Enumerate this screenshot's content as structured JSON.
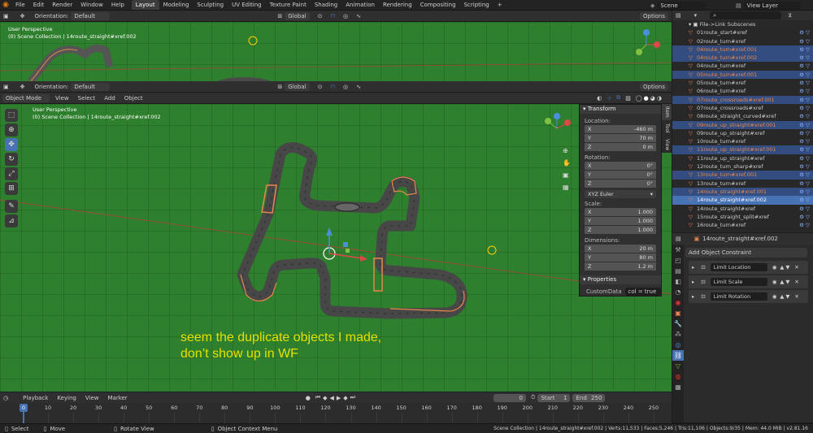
{
  "topbar": {
    "menus": [
      "File",
      "Edit",
      "Render",
      "Window",
      "Help"
    ],
    "workspaces": [
      "Layout",
      "Modeling",
      "Sculpting",
      "UV Editing",
      "Texture Paint",
      "Shading",
      "Animation",
      "Rendering",
      "Compositing",
      "Scripting"
    ],
    "active_workspace": "Layout",
    "scene": "Scene",
    "view_layer": "View Layer"
  },
  "viewport_top": {
    "orientation_label": "Orientation:",
    "orientation_value": "Default",
    "transform_space": "Global",
    "options": "Options",
    "overlay_line1": "User Perspective",
    "overlay_line2": "(0) Scene Collection | 14route_straight#xref.002"
  },
  "viewport_main": {
    "orientation_label": "Orientation:",
    "orientation_value": "Default",
    "transform_space": "Global",
    "options": "Options",
    "mode": "Object Mode",
    "menu": [
      "View",
      "Select",
      "Add",
      "Object"
    ],
    "overlay_line1": "User Perspective",
    "overlay_line2": "(0) Scene Collection | 14route_straight#xref.002",
    "annotation_line1": "seem the duplicate objects I made,",
    "annotation_line2": "don’t show up in WF",
    "background": "#2e7f2e"
  },
  "npanel": {
    "tabs": [
      "Item",
      "Tool",
      "View"
    ],
    "transform_title": "Transform",
    "location_label": "Location:",
    "location": [
      {
        "axis": "X",
        "value": "-460 m"
      },
      {
        "axis": "Y",
        "value": "70 m"
      },
      {
        "axis": "Z",
        "value": "0 m"
      }
    ],
    "rotation_label": "Rotation:",
    "rotation": [
      {
        "axis": "X",
        "value": "0°"
      },
      {
        "axis": "Y",
        "value": "0°"
      },
      {
        "axis": "Z",
        "value": "0°"
      }
    ],
    "rotation_mode": "XYZ Euler",
    "scale_label": "Scale:",
    "scale": [
      {
        "axis": "X",
        "value": "1.000"
      },
      {
        "axis": "Y",
        "value": "1.000"
      },
      {
        "axis": "Z",
        "value": "1.000"
      }
    ],
    "dimensions_label": "Dimensions:",
    "dimensions": [
      {
        "axis": "X",
        "value": "20 m"
      },
      {
        "axis": "Y",
        "value": "80 m"
      },
      {
        "axis": "Z",
        "value": "1.2 m"
      }
    ],
    "properties_title": "Properties",
    "custom_key": "CustomData",
    "custom_value": "col = true"
  },
  "outliner": {
    "search_placeholder": "",
    "collection": "File->Link Subscenes",
    "items": [
      {
        "name": "01route_start#xref",
        "state": "normal"
      },
      {
        "name": "02route_turn#xref",
        "state": "normal"
      },
      {
        "name": "04route_turn#xref.001",
        "state": "sel-hl"
      },
      {
        "name": "04route_turn#xref.002",
        "state": "sel-hl"
      },
      {
        "name": "04route_turn#xref",
        "state": "normal"
      },
      {
        "name": "05route_turn#xref.001",
        "state": "sel-hl"
      },
      {
        "name": "05route_turn#xref",
        "state": "normal"
      },
      {
        "name": "06route_turn#xref",
        "state": "normal"
      },
      {
        "name": "07route_crossroads#xref.001",
        "state": "sel-hl"
      },
      {
        "name": "07route_crossroads#xref",
        "state": "normal"
      },
      {
        "name": "08route_straight_curved#xref",
        "state": "normal"
      },
      {
        "name": "09route_up_straight#xref.001",
        "state": "sel-hl"
      },
      {
        "name": "09route_up_straight#xref",
        "state": "normal"
      },
      {
        "name": "10route_turn#xref",
        "state": "normal"
      },
      {
        "name": "11route_up_straight#xref.001",
        "state": "sel-hl"
      },
      {
        "name": "11route_up_straight#xref",
        "state": "normal"
      },
      {
        "name": "12route_turn_sharp#xref",
        "state": "normal"
      },
      {
        "name": "13route_turn#xref.001",
        "state": "sel-hl"
      },
      {
        "name": "13route_turn#xref",
        "state": "normal"
      },
      {
        "name": "14route_straight#xref.001",
        "state": "sel-hl"
      },
      {
        "name": "14route_straight#xref.002",
        "state": "active"
      },
      {
        "name": "14route_straight#xref",
        "state": "normal"
      },
      {
        "name": "15route_straight_split#xref",
        "state": "normal"
      },
      {
        "name": "16route_turn#xref",
        "state": "normal"
      }
    ]
  },
  "properties_editor": {
    "object_name": "14route_straight#xref.002",
    "add_constraint": "Add Object Constraint",
    "constraints": [
      "Limit Location",
      "Limit Scale",
      "Limit Rotation"
    ]
  },
  "timeline": {
    "menu": [
      "Playback",
      "Keying",
      "View",
      "Marker"
    ],
    "current_frame": "0",
    "start_label": "Start",
    "start": "1",
    "end_label": "End",
    "end": "250",
    "ticks": [
      "0",
      "10",
      "20",
      "30",
      "40",
      "50",
      "60",
      "70",
      "80",
      "90",
      "100",
      "110",
      "120",
      "130",
      "140",
      "150",
      "160",
      "170",
      "180",
      "190",
      "200",
      "210",
      "220",
      "230",
      "240",
      "250"
    ]
  },
  "statusbar": {
    "select": "Select",
    "move": "Move",
    "rotate_view": "Rotate View",
    "context_menu": "Object Context Menu",
    "stats": "Scene Collection | 14route_straight#xref.002 | Verts:11,533 | Faces:5,246 | Tris:11,106 | Objects:9/35 | Mem: 44.0 MiB | v2.81.16"
  },
  "colors": {
    "accent": "#4772b3",
    "selection_outline": "#e8874c",
    "viewport_green": "#2e7f2e",
    "annotation_yellow": "#e6e000"
  }
}
